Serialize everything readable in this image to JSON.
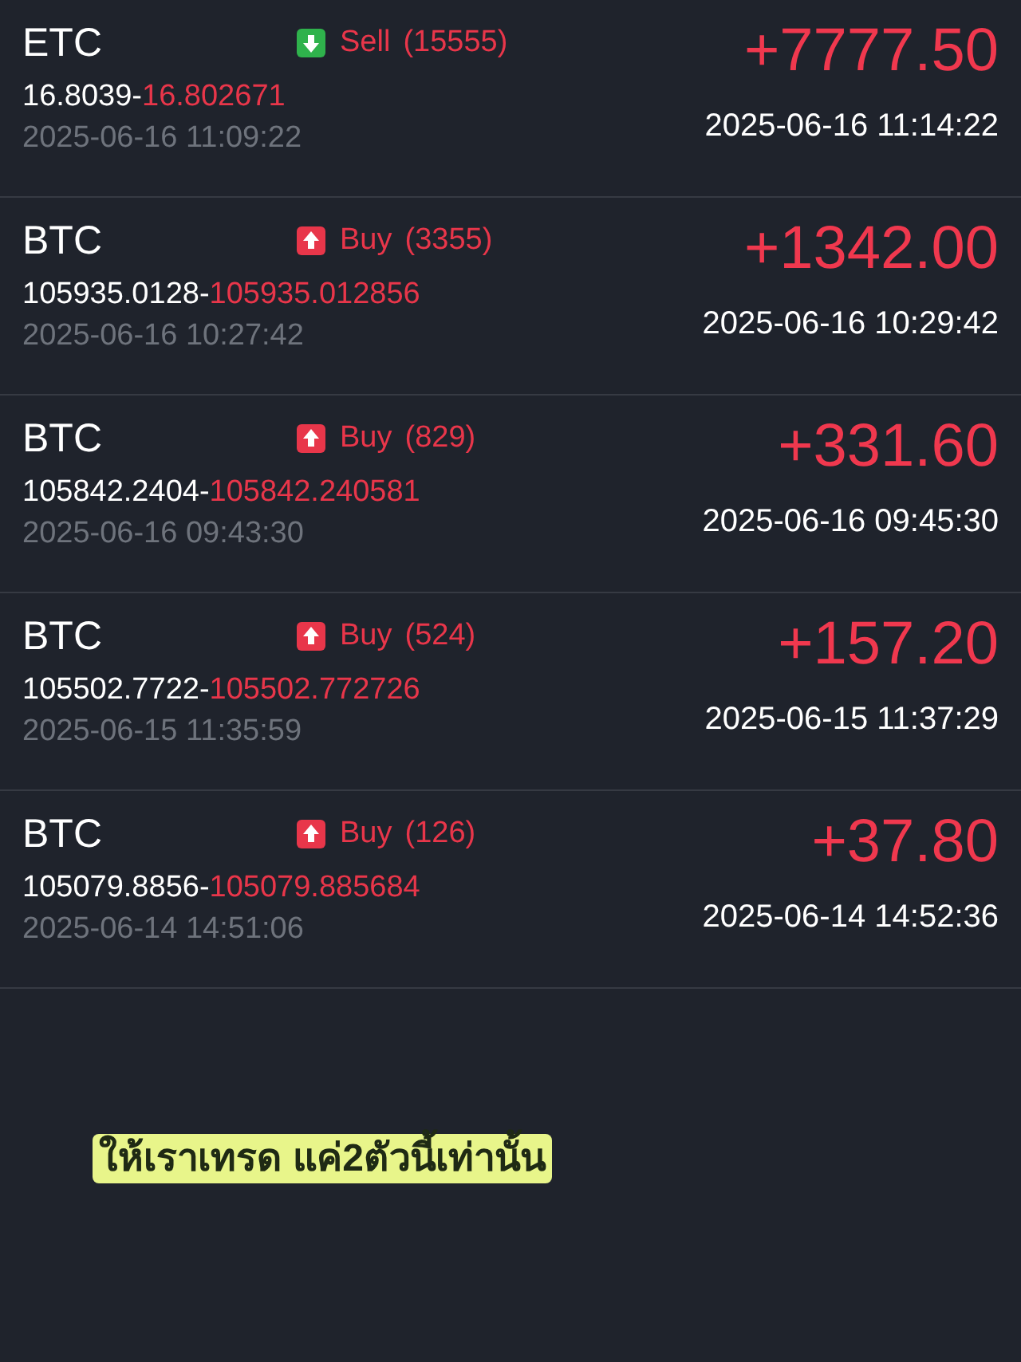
{
  "trades": [
    {
      "symbol": "ETC",
      "kind": "sell",
      "side_label": "Sell",
      "quantity": "(15555)",
      "open_price": "16.8039-",
      "close_price": "16.802671",
      "open_time": "2025-06-16 11:09:22",
      "profit": "+7777.50",
      "close_time": "2025-06-16 11:14:22"
    },
    {
      "symbol": "BTC",
      "kind": "buy",
      "side_label": "Buy",
      "quantity": "(3355)",
      "open_price": "105935.0128-",
      "close_price": "105935.012856",
      "open_time": "2025-06-16 10:27:42",
      "profit": "+1342.00",
      "close_time": "2025-06-16 10:29:42"
    },
    {
      "symbol": "BTC",
      "kind": "buy",
      "side_label": "Buy",
      "quantity": "(829)",
      "open_price": "105842.2404-",
      "close_price": "105842.240581",
      "open_time": "2025-06-16 09:43:30",
      "profit": "+331.60",
      "close_time": "2025-06-16 09:45:30"
    },
    {
      "symbol": "BTC",
      "kind": "buy",
      "side_label": "Buy",
      "quantity": "(524)",
      "open_price": "105502.7722-",
      "close_price": "105502.772726",
      "open_time": "2025-06-15 11:35:59",
      "profit": "+157.20",
      "close_time": "2025-06-15 11:37:29"
    },
    {
      "symbol": "BTC",
      "kind": "buy",
      "side_label": "Buy",
      "quantity": "(126)",
      "open_price": "105079.8856-",
      "close_price": "105079.885684",
      "open_time": "2025-06-14 14:51:06",
      "profit": "+37.80",
      "close_time": "2025-06-14 14:52:36"
    }
  ],
  "caption": "ให้เราเทรด แค่2ตัวนี้เท่านั้น"
}
